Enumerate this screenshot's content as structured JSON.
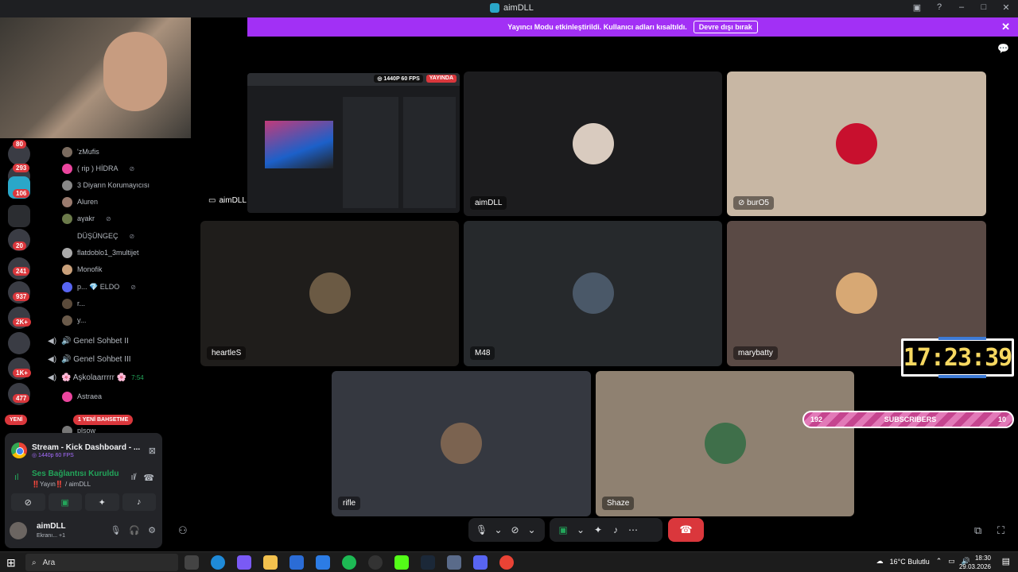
{
  "window": {
    "title": "aimDLL"
  },
  "notice": {
    "text": "Yayıncı Modu etkinleştirildi. Kullanıcı adları kısaltıldı.",
    "button": "Devre dışı bırak",
    "close": "✕"
  },
  "servers": {
    "badges": [
      "80",
      "293",
      "106",
      "20",
      "241",
      "937",
      "2K+",
      "1K+",
      "477"
    ]
  },
  "channels": {
    "members": [
      {
        "name": "'zMufis",
        "muted": false
      },
      {
        "name": "( rip ) HİDRA",
        "muted": true
      },
      {
        "name": "3 Diyarın Korumayıcısı",
        "muted": false
      },
      {
        "name": "Aluren",
        "muted": false
      },
      {
        "name": "aγakr",
        "muted": true
      },
      {
        "name": "DÜŞÜNGEÇ",
        "muted": true
      },
      {
        "name": "flatdoblo1_3multijet",
        "muted": false
      },
      {
        "name": "Monofik",
        "muted": false
      },
      {
        "name": "p... 💎 ELDO",
        "muted": true
      },
      {
        "name": "r...",
        "muted": false
      },
      {
        "name": "y...",
        "muted": false
      }
    ],
    "voice": [
      {
        "name": "🔊 Genel Sohbet II",
        "extra": ""
      },
      {
        "name": "🔊 Genel Sohbet III",
        "extra": ""
      },
      {
        "name": "🌸 Aşkolaarrrrr 🌸",
        "extra": "7:54"
      }
    ],
    "sub_members": [
      {
        "name": "Astraea"
      },
      {
        "name": "plsow"
      }
    ],
    "new_pill": "YENİ",
    "mention_pill": "1 YENİ BAHSETME"
  },
  "userpanel": {
    "stream_title": "Stream - Kick Dashboard - ...",
    "stream_sub": "◎ 1440p 60 FPS",
    "conn_title": "Ses Bağlantısı Kuruldu",
    "conn_sub": "‼️Yayın‼️ / aimDLL",
    "me_name": "aimDLL",
    "me_sub": "Ekranı... +1"
  },
  "tiles": [
    {
      "name": "aimDLL",
      "color": "#1c1c1e"
    },
    {
      "name": "burO5",
      "color": "#c8b7a4"
    },
    {
      "name": "heartleS",
      "color": "#1f1d1b"
    },
    {
      "name": "M48",
      "color": "#26292c"
    },
    {
      "name": "marybatty",
      "color": "#5a4a45"
    },
    {
      "name": "rifle",
      "color": "#353840"
    },
    {
      "name": "Shaze",
      "color": "#8f8171"
    }
  ],
  "screen_share": {
    "owner": "aimDLL",
    "quality": "◎ 1440P 60 FPS",
    "live": "YAYINDA"
  },
  "overlay": {
    "clock": "17:23:39",
    "subs_left": "192",
    "subs_label": "SUBSCRIBERS",
    "subs_right": "10"
  },
  "taskbar": {
    "search": "Ara",
    "weather": "16°C Bulutlu",
    "time": "18:30",
    "date": "29.03.2026"
  }
}
